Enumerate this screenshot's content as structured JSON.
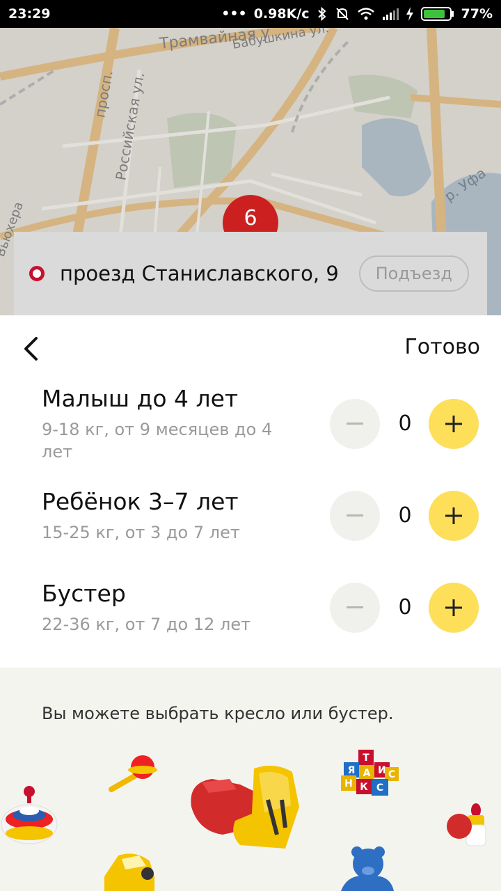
{
  "status_bar": {
    "time": "23:29",
    "net_speed": "0.98K/c",
    "battery": "77%"
  },
  "map": {
    "labels": [
      "Трамвайная у",
      "просп.",
      "Российская ул.",
      "Бабушкина ул.",
      "р. Уфа",
      "Вьюхера"
    ],
    "pin_number": "6"
  },
  "address": {
    "text": "проезд Станиславского, 9",
    "entrance_label": "Подъезд"
  },
  "sheet": {
    "done_label": "Готово",
    "seats": [
      {
        "title": "Малыш до 4 лет",
        "desc": "9-18 кг, от 9 месяцев до 4 лет",
        "count": "0"
      },
      {
        "title": "Ребёнок 3–7 лет",
        "desc": "15-25 кг, от 3 до 7 лет",
        "count": "0"
      },
      {
        "title": "Бустер",
        "desc": "22-36 кг, от 7 до 12 лет",
        "count": "0"
      }
    ]
  },
  "info": {
    "text": "Вы можете выбрать кресло или бустер.",
    "cube_letters": [
      "Я",
      "А",
      "И",
      "С",
      "Н",
      "К",
      "С",
      "Т"
    ]
  },
  "colors": {
    "accent_yellow": "#fddf5a",
    "pin_red": "#cc2020",
    "address_dot": "#c8102e"
  }
}
